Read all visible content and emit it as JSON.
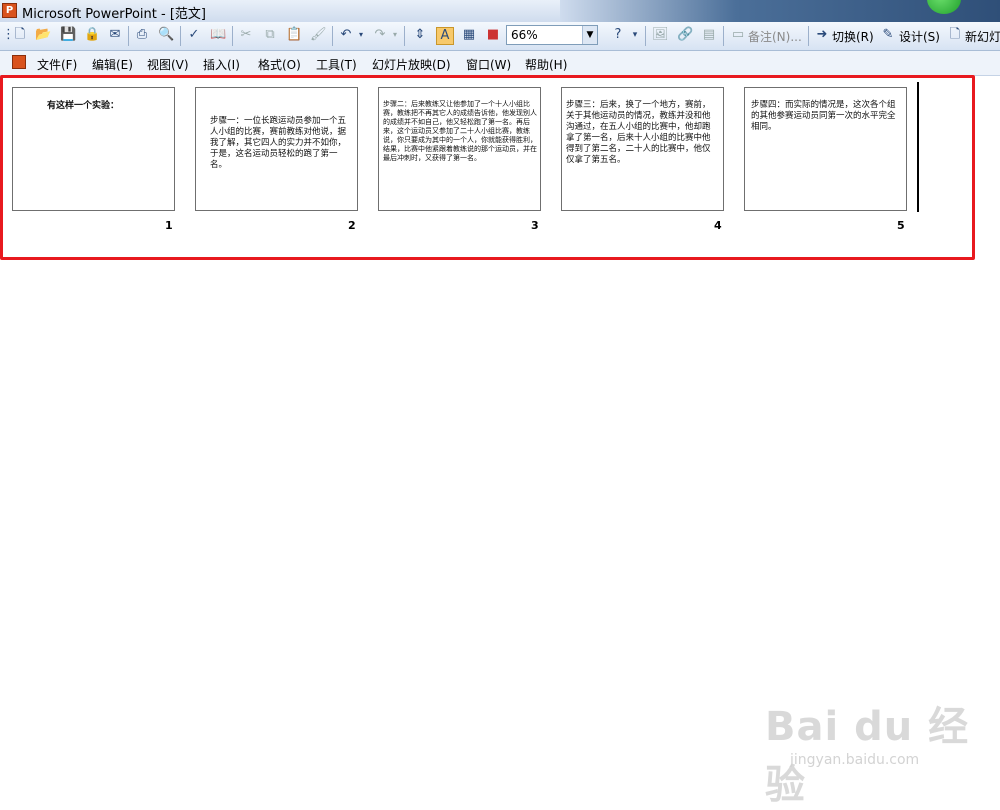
{
  "window": {
    "title": "Microsoft PowerPoint - [范文]"
  },
  "toolbar": {
    "zoom": "66%",
    "notes_label": "备注(N)...",
    "transition_label": "切换(R)",
    "design_label": "设计(S)",
    "new_slide_label": "新幻灯"
  },
  "menu": {
    "items": [
      "文件(F)",
      "编辑(E)",
      "视图(V)",
      "插入(I)",
      "格式(O)",
      "工具(T)",
      "幻灯片放映(D)",
      "窗口(W)",
      "帮助(H)"
    ]
  },
  "slides": [
    {
      "number": "1",
      "text": "有这样一个实验："
    },
    {
      "number": "2",
      "text": "步骤一：一位长跑运动员参加一个五人小组的比赛，赛前教练对他说，据我了解，其它四人的实力并不如你，于是，这名运动员轻松的跑了第一名。"
    },
    {
      "number": "3",
      "text": "步骤二：后来教练又让他参加了一个十人小组比赛，教练把不再其它人的成绩告诉他，他发现别人的成绩并不如自己，他又轻松跑了第一名。再后来，这个运动员又参加了二十人小组比赛，教练说，你只要成为其中的一个人，你就能获得胜利，结果，比赛中他紧跟着教练说的那个运动员，并在最后冲刺时，又获得了第一名。"
    },
    {
      "number": "4",
      "text": "步骤三：后来，换了一个地方，赛前，关于其他运动员的情况，教练并没和他沟通过，在五人小组的比赛中，他却跑拿了第一名，后来十人小组的比赛中他得到了第二名，二十人的比赛中，他仅仅拿了第五名。"
    },
    {
      "number": "5",
      "text": "步骤四：而实际的情况是，这次各个组的其他参赛运动员同第一次的水平完全相同。"
    }
  ],
  "watermark": {
    "logo": "Bai du 经验",
    "url": "jingyan.baidu.com"
  }
}
